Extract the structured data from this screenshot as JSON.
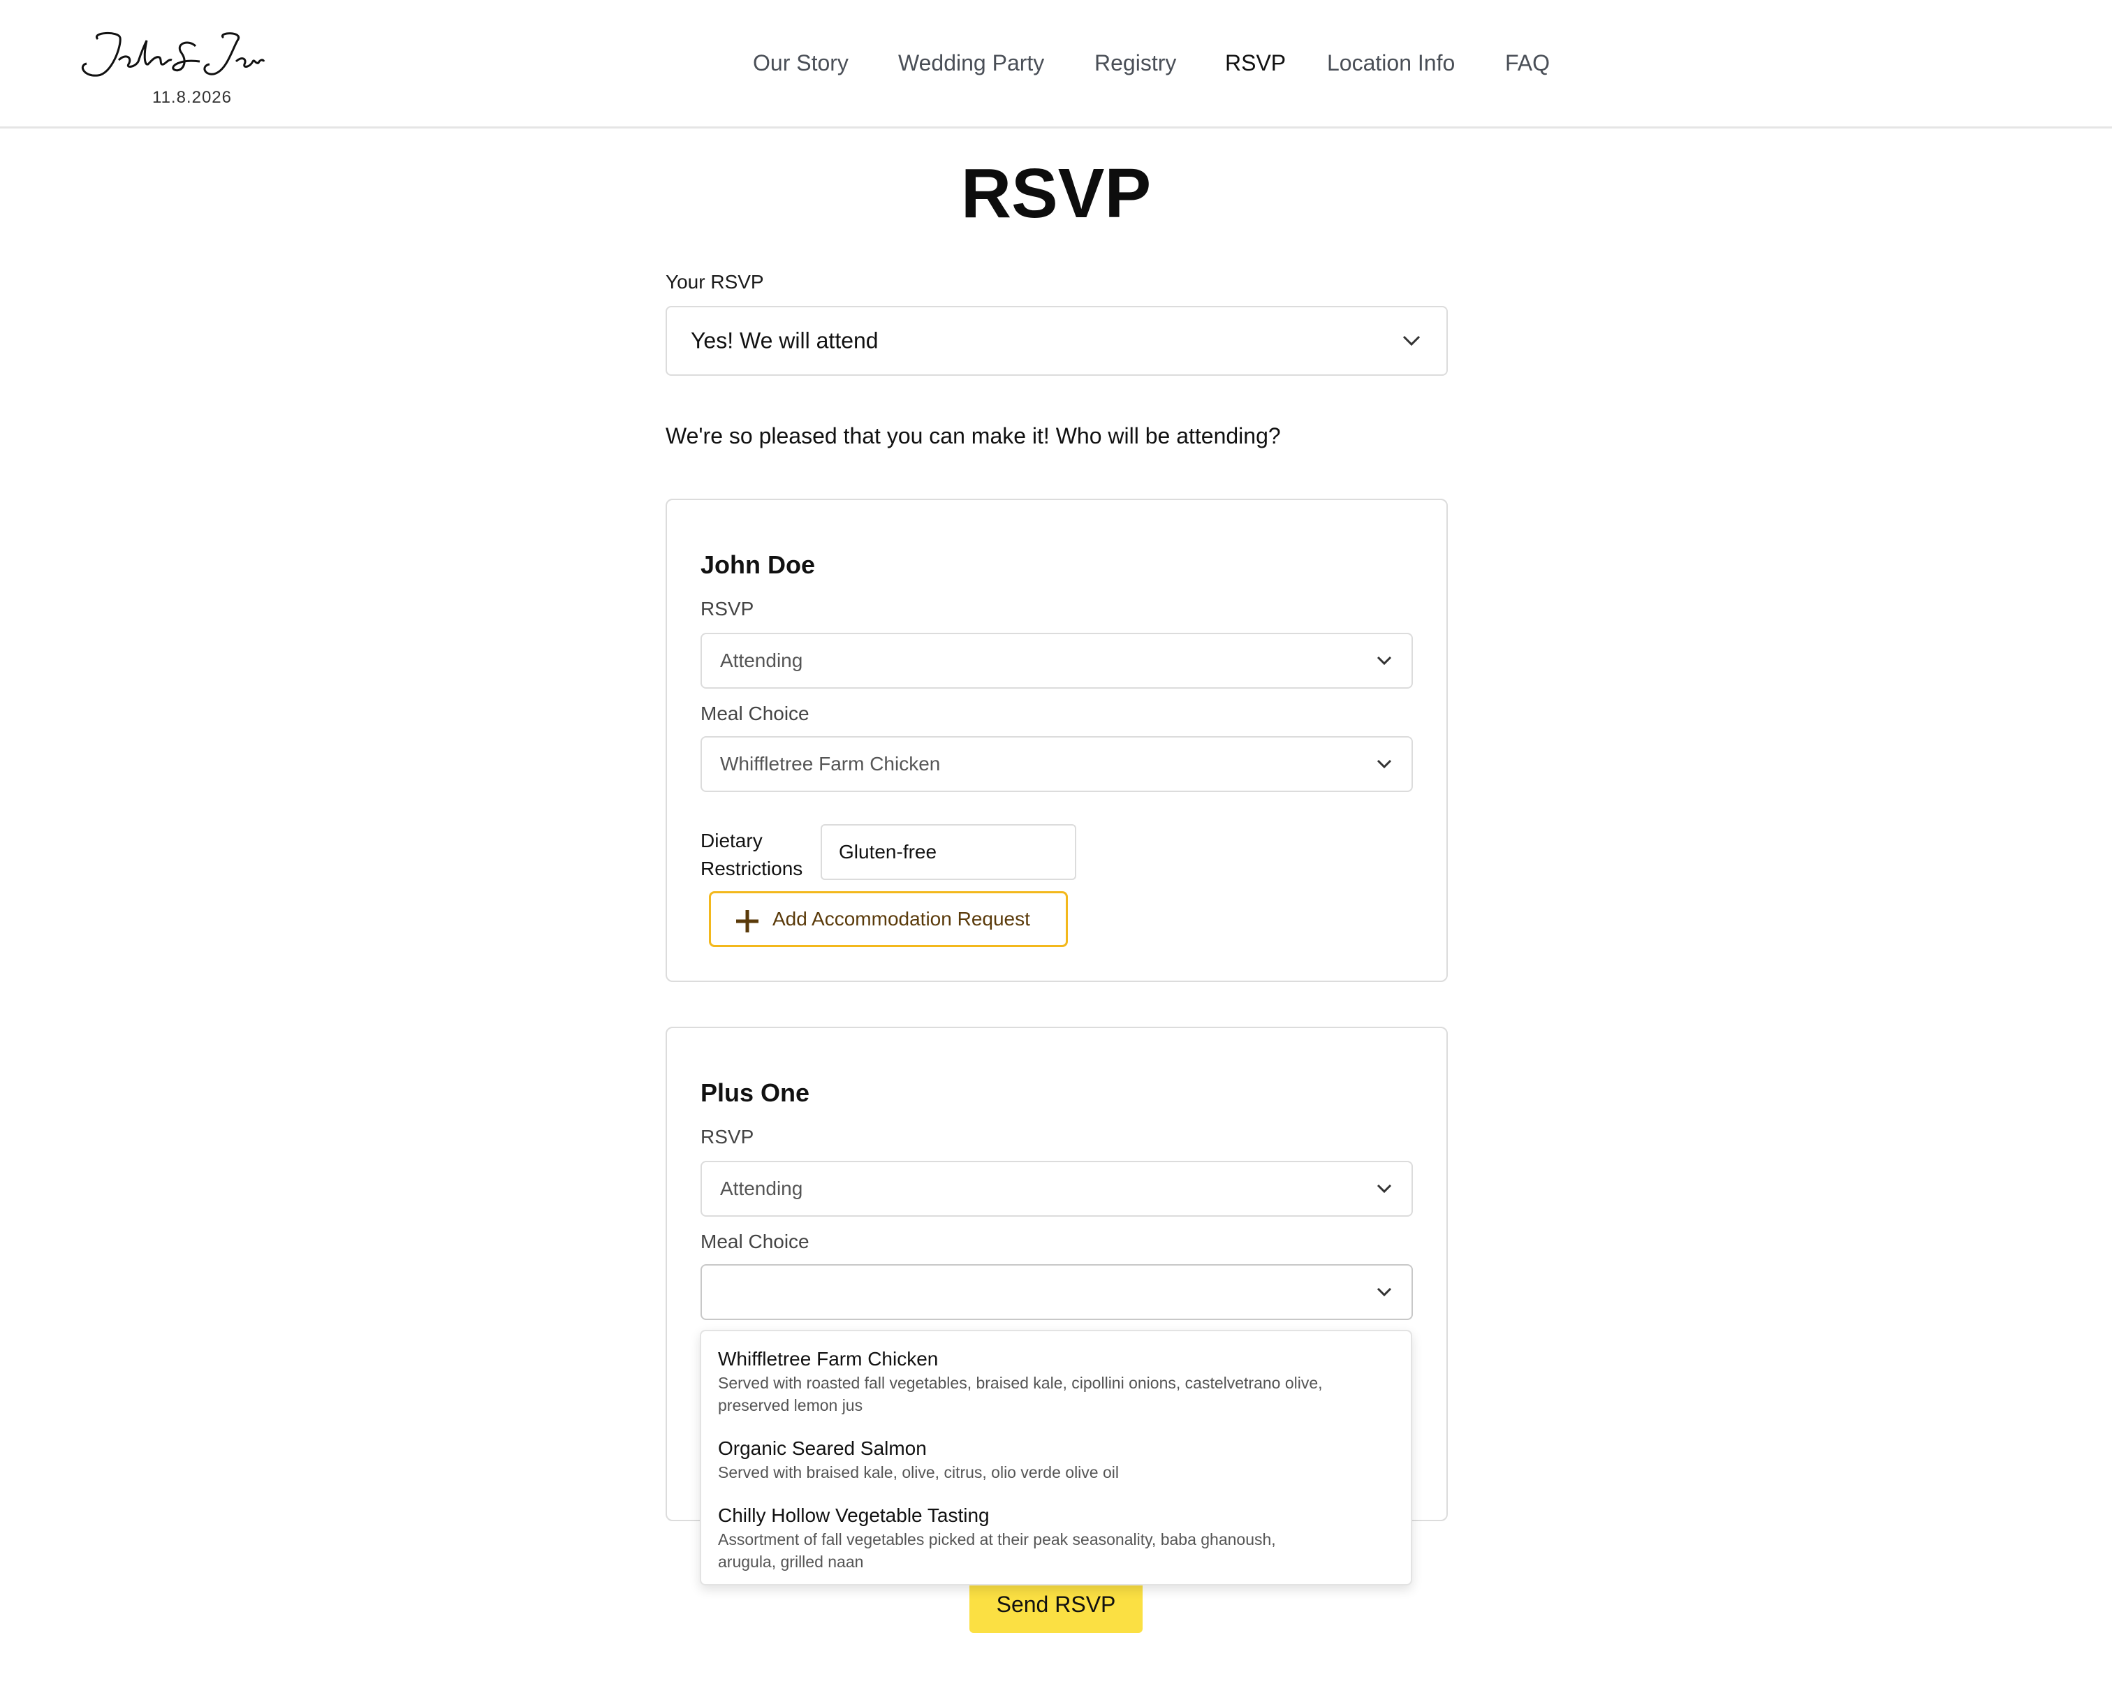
{
  "logo": {
    "script_text": "John & Jane",
    "date": "11.8.2026"
  },
  "nav": [
    {
      "label": "Our Story"
    },
    {
      "label": "Wedding Party"
    },
    {
      "label": "Registry"
    },
    {
      "label": "RSVP",
      "active": true
    },
    {
      "label": "Location Info"
    },
    {
      "label": "FAQ"
    }
  ],
  "page_title": "RSVP",
  "your_rsvp": {
    "label": "Your RSVP",
    "value": "Yes! We will attend"
  },
  "intro_text": "We're so pleased that you can make it! Who will be attending?",
  "guests": [
    {
      "name": "John Doe",
      "rsvp_label": "RSVP",
      "rsvp_value": "Attending",
      "meal_label": "Meal Choice",
      "meal_value": "Whiffletree Farm Chicken",
      "dietary_label_line1": "Dietary",
      "dietary_label_line2": "Restrictions",
      "dietary_value": "Gluten-free",
      "accommodation_button": "Add Accommodation Request"
    },
    {
      "name": "Plus One",
      "rsvp_label": "RSVP",
      "rsvp_value": "Attending",
      "meal_label": "Meal Choice",
      "meal_value": ""
    }
  ],
  "meal_options": [
    {
      "name": "Whiffletree Farm Chicken",
      "desc_line1": "Served with roasted fall vegetables, braised kale, cipollini onions, castelvetrano olive,",
      "desc_line2": "preserved lemon jus"
    },
    {
      "name": "Organic Seared Salmon",
      "desc_line1": "Served with braised kale, olive, citrus, olio verde olive oil",
      "desc_line2": ""
    },
    {
      "name": "Chilly Hollow Vegetable Tasting",
      "desc_line1": "Assortment of fall vegetables picked at their peak seasonality, baba ghanoush,",
      "desc_line2": "arugula, grilled naan"
    }
  ],
  "send_button": "Send RSVP",
  "colors": {
    "accent_yellow": "#fbe043",
    "accent_border": "#f3b81c",
    "accent_text": "#5a3a0a"
  },
  "icons": {
    "chevron": "chevron-down-icon",
    "plus": "plus-icon"
  }
}
